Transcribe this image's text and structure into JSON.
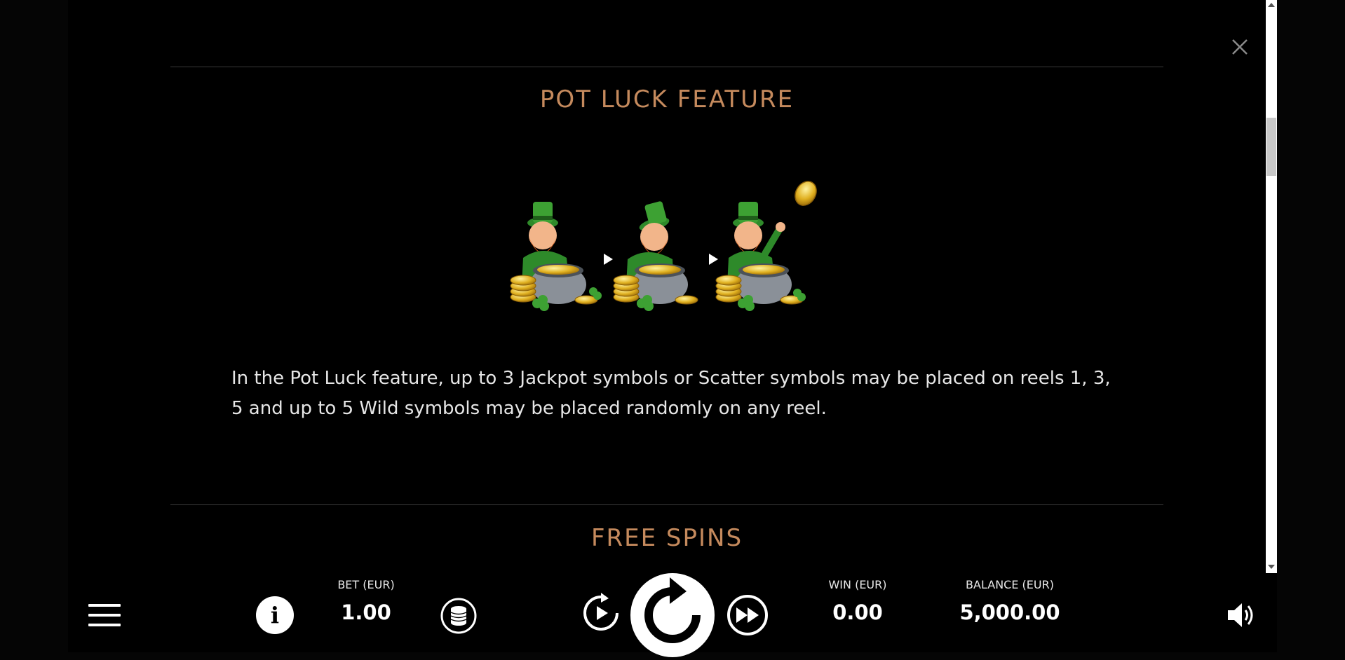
{
  "info": {
    "section1": {
      "title": "POT LUCK FEATURE",
      "description": "In the Pot Luck feature, up to 3 Jackpot symbols or Scatter symbols may be placed on reels 1, 3, 5 and up to 5 Wild symbols may be placed randomly on any reel."
    },
    "section2": {
      "title": "FREE SPINS"
    }
  },
  "controls": {
    "bet": {
      "label": "BET (EUR)",
      "value": "1.00"
    },
    "win": {
      "label": "WIN (EUR)",
      "value": "0.00"
    },
    "balance": {
      "label": "BALANCE (EUR)",
      "value": "5,000.00"
    },
    "info_icon": "i"
  },
  "icons": {
    "close": "close-icon",
    "menu": "hamburger-menu-icon",
    "info": "info-icon",
    "coins": "coin-stack-icon",
    "autoplay": "autoplay-icon",
    "spin": "spin-icon",
    "turbo": "fast-forward-icon",
    "sound": "speaker-icon"
  },
  "colors": {
    "accent": "#c58a5d",
    "background": "#000000",
    "text": "#e6e6e6"
  }
}
